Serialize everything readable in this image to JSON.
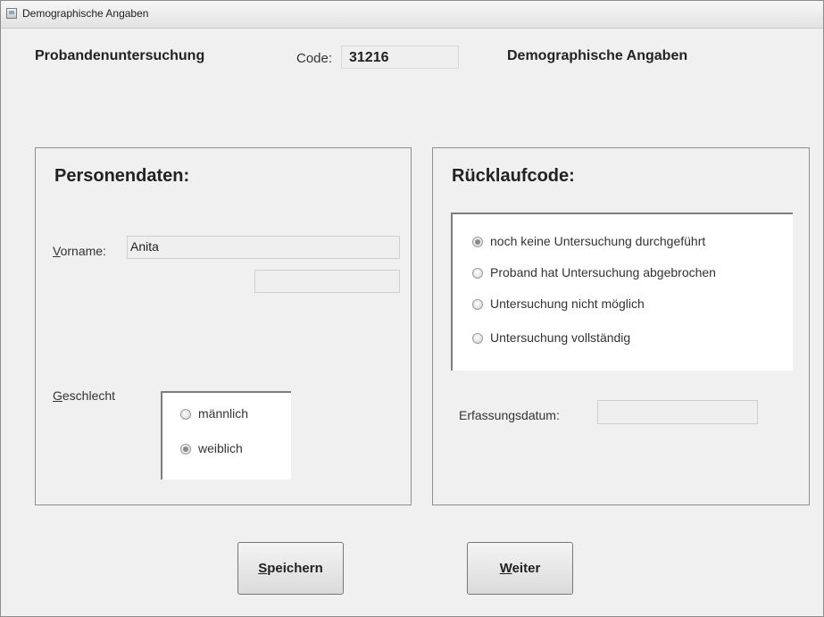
{
  "window": {
    "title": "Demographische Angaben",
    "icon": "window-form-icon"
  },
  "header": {
    "left_title": "Probandenuntersuchung",
    "code_label": "Code:",
    "code_value": "31216",
    "right_title": "Demographische Angaben"
  },
  "personendaten": {
    "title": "Personendaten:",
    "vorname_label_mnemonic": "V",
    "vorname_label_rest": "orname:",
    "vorname_value": "Anita",
    "second_field_value": "",
    "geschlecht_label_mnemonic": "G",
    "geschlecht_label_rest": "eschlecht",
    "geschlecht_options": [
      {
        "label": "männlich",
        "checked": false
      },
      {
        "label": "weiblich",
        "checked": true
      }
    ]
  },
  "ruecklauf": {
    "title": "Rücklaufcode:",
    "options": [
      {
        "label": "noch keine Untersuchung durchgeführt",
        "checked": true
      },
      {
        "label": "Proband hat Untersuchung abgebrochen",
        "checked": false
      },
      {
        "label": "Untersuchung nicht möglich",
        "checked": false
      },
      {
        "label": "Untersuchung vollständig",
        "checked": false
      }
    ],
    "erfassungsdatum_label": "Erfassungsdatum:",
    "erfassungsdatum_value": ""
  },
  "buttons": {
    "save_mnemonic": "S",
    "save_rest": "peichern",
    "next_mnemonic": "W",
    "next_rest": "eiter"
  }
}
